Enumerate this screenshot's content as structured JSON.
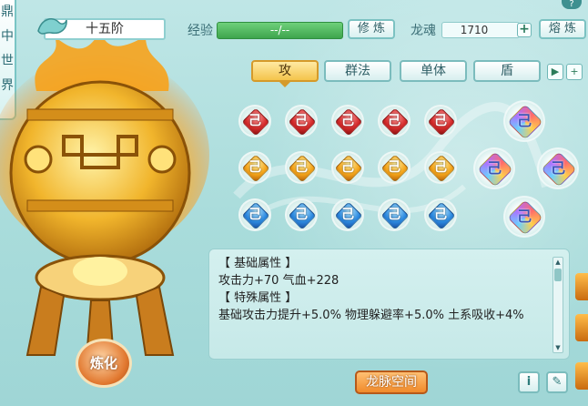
{
  "window": {
    "vertical_tabs": [
      "鼎",
      "中",
      "世",
      "界"
    ],
    "stage_title": "十五阶",
    "help_label": "?"
  },
  "top_bar": {
    "exp_label": "经验",
    "exp_value": "--/--",
    "cultivate_button": "修 炼",
    "soul_label": "龙魂",
    "soul_value": "1710",
    "plus_label": "+",
    "smelt_button": "熔 炼"
  },
  "tabs": [
    {
      "label": "攻",
      "active": true
    },
    {
      "label": "群法",
      "active": false
    },
    {
      "label": "单体",
      "active": false
    },
    {
      "label": "盾",
      "active": false
    }
  ],
  "tab_nav": {
    "next_label": "▶",
    "add_label": "+"
  },
  "gems": {
    "glyph": "己",
    "rows": [
      {
        "color": "red",
        "count": 5
      },
      {
        "color": "orange",
        "count": 5
      },
      {
        "color": "blue",
        "count": 5
      }
    ],
    "special_count": 4
  },
  "info": {
    "base_header": "【 基础属性 】",
    "base_line": "攻击力+70  气血+228",
    "special_header": "【 特殊属性 】",
    "special_line": "基础攻击力提升+5.0%  物理躲避率+5.0%  土系吸收+4%"
  },
  "bottom": {
    "dragon_space_button": "龙脉空间",
    "info_button": "i",
    "edit_button": "✎",
    "refine_button": "炼化"
  },
  "colors": {
    "bg": "#a9dcdb",
    "accent_teal": "#7bbcbd",
    "active_tab": "#f4c44c",
    "exp_bar": "#3ea54d",
    "orange_button": "#f08a2a"
  }
}
